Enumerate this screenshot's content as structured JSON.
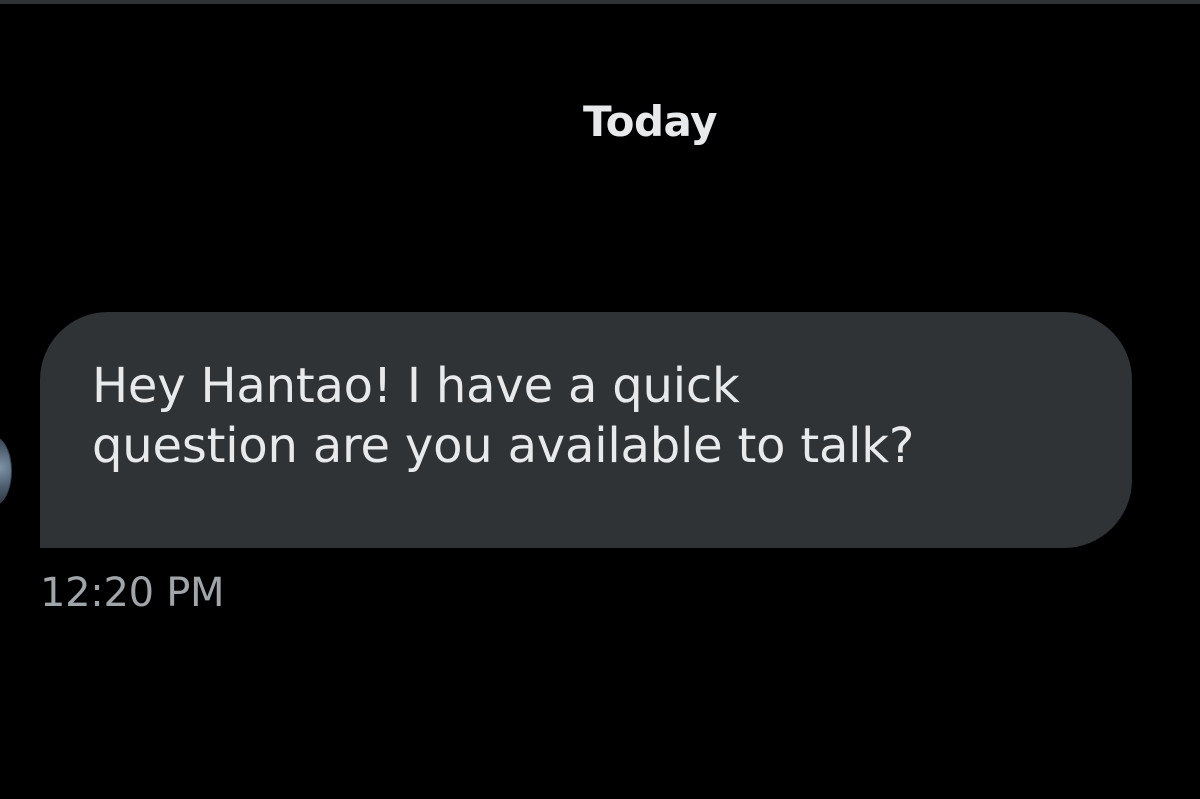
{
  "conversation": {
    "date_divider": "Today",
    "messages": [
      {
        "text": "Hey Hantao! I have a quick\nquestion are you available to talk?",
        "time": "12:20 PM",
        "direction": "incoming"
      }
    ]
  },
  "colors": {
    "background": "#000000",
    "bubble": "#2f3336",
    "text": "#e7e9ea",
    "muted_text": "#a0a5aa"
  }
}
